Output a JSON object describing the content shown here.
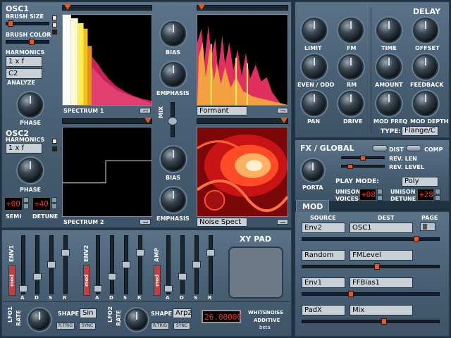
{
  "osc1": {
    "title": "OSC1",
    "brush_size": "BRUSH SIZE",
    "brush_color": "BRUSH COLOR",
    "harmonics": "HARMONICS",
    "harmonics_value": "1 x f",
    "note": "C2",
    "analyze": "ANALYZE",
    "phase": "PHASE",
    "spectrum": "SPECTRUM 1",
    "bias": "BIAS",
    "emphasis": "EMPHASIS",
    "mode": "Formant"
  },
  "osc2": {
    "title": "OSC2",
    "harmonics": "HARMONICS",
    "harmonics_value": "1 x f",
    "phase": "PHASE",
    "semi": "SEMI",
    "semi_value": "+00",
    "detune": "DETUNE",
    "detune_value": "+40",
    "spectrum": "SPECTRUM 2",
    "bias": "BIAS",
    "emphasis": "EMPHASIS",
    "mode": "Noise Spect"
  },
  "mix": "MIX",
  "delay": {
    "title": "DELAY",
    "time": "TIME",
    "offset": "OFFSET",
    "amount": "AMOUNT",
    "feedback": "FEEDBACK",
    "mod_freq": "MOD FREQ",
    "mod_depth": "MOD DEPTH",
    "type_label": "TYPE:",
    "type_value": "Flange/C"
  },
  "fx": {
    "limit": "LIMIT",
    "fm": "FM",
    "even_odd": "EVEN / ODD",
    "rm": "RM",
    "pan": "PAN",
    "drive": "DRIVE"
  },
  "global": {
    "title": "FX / GLOBAL",
    "dist": "DIST",
    "comp": "COMP",
    "rev_len": "REV. LEN",
    "rev_level": "REV. LEVEL",
    "porta": "PORTA",
    "play_mode": "PLAY MODE:",
    "play_mode_value": "Poly",
    "unison_voices": "UNISON\nVOICES",
    "unison_voices_value": "+08",
    "unison_detune": "UNISON\nDETUNE",
    "unison_detune_value": "+28"
  },
  "mod": {
    "tab": "MOD",
    "source": "SOURCE",
    "dest": "DEST",
    "page": "PAGE",
    "rows": [
      {
        "source": "Env2",
        "dest": "OSC1",
        "amount": 0.85
      },
      {
        "source": "Random",
        "dest": "FMLevel",
        "amount": 0.55
      },
      {
        "source": "Env1",
        "dest": "FFBias1",
        "amount": 0.35
      },
      {
        "source": "PadX",
        "dest": "Mix",
        "amount": 0.6
      }
    ]
  },
  "env1": {
    "label": "ENV1",
    "mod": "mod",
    "sliders": [
      "A",
      "D",
      "S",
      "R"
    ]
  },
  "env2": {
    "label": "ENV2",
    "mod": "mod",
    "sliders": [
      "A",
      "D",
      "S",
      "R"
    ]
  },
  "amp": {
    "label": "AMP",
    "mod": "mod",
    "sliders": [
      "A",
      "D",
      "S",
      "R"
    ]
  },
  "xy_pad": "XY PAD",
  "lfo1": {
    "label": "LFO1",
    "rate": "RATE",
    "shape": "SHAPE",
    "shape_value": "Sin",
    "retrig": "R.TRIG",
    "sync": "SYNC"
  },
  "lfo2": {
    "label": "LFO2",
    "rate": "RATE",
    "shape": "SHAPE",
    "shape_value": "Arp2",
    "retrig": "R.TRIG",
    "sync": "SYNC"
  },
  "display_value": "26.00000",
  "brand": {
    "line1": "WHITENOISE",
    "line2": "ADDITIVE",
    "line3": "beta"
  },
  "colors": {
    "accent": "#e05a20",
    "led": "#ff3020",
    "panel": "#4f667b"
  }
}
